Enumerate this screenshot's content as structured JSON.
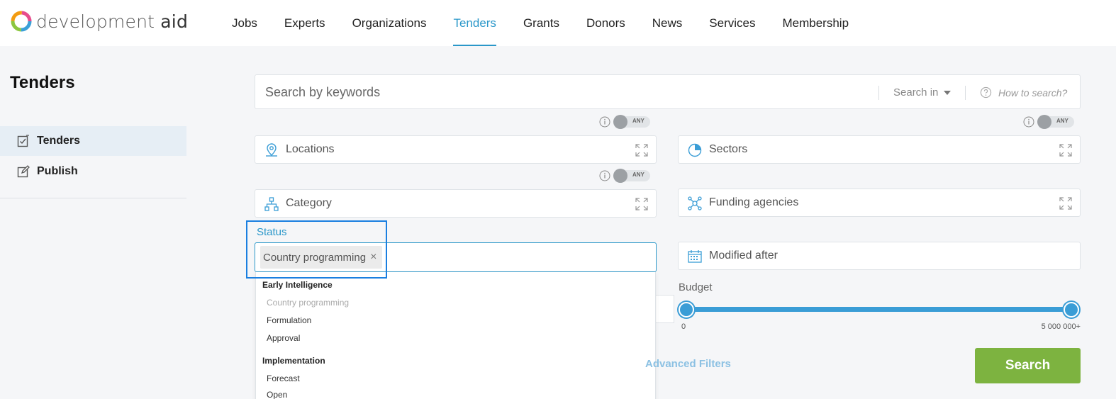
{
  "brand": {
    "name_light": "development",
    "name_bold": "aid"
  },
  "nav": {
    "items": [
      {
        "label": "Jobs"
      },
      {
        "label": "Experts"
      },
      {
        "label": "Organizations"
      },
      {
        "label": "Tenders",
        "active": true
      },
      {
        "label": "Grants"
      },
      {
        "label": "Donors"
      },
      {
        "label": "News"
      },
      {
        "label": "Services"
      },
      {
        "label": "Membership"
      }
    ]
  },
  "sidebar": {
    "title": "Tenders",
    "items": [
      {
        "label": "Tenders",
        "icon": "checklist-icon",
        "active": true
      },
      {
        "label": "Publish",
        "icon": "edit-icon"
      }
    ]
  },
  "search": {
    "placeholder": "Search by keywords",
    "search_in_label": "Search in",
    "how_to_label": "How to search?"
  },
  "toggles": {
    "any_label": "ANY"
  },
  "filters": {
    "locations": "Locations",
    "sectors": "Sectors",
    "category": "Category",
    "funding_agencies": "Funding agencies",
    "modified_after": "Modified after"
  },
  "status": {
    "label": "Status",
    "selected_chip": "Country programming",
    "chip_remove": "×",
    "dropdown": {
      "groups": [
        {
          "label": "Early Intelligence",
          "items": [
            {
              "label": "Country programming",
              "disabled": true
            },
            {
              "label": "Formulation"
            },
            {
              "label": "Approval"
            }
          ]
        },
        {
          "label": "Implementation",
          "items": [
            {
              "label": "Forecast"
            },
            {
              "label": "Open"
            }
          ]
        }
      ]
    }
  },
  "budget": {
    "label": "Budget",
    "min_label": "0",
    "max_label": "5 000 000+"
  },
  "advanced_filters": "Advanced Filters",
  "search_button": "Search",
  "colors": {
    "accent": "#2a97c9",
    "search_button": "#7db340",
    "slider": "#3a9dd6"
  }
}
